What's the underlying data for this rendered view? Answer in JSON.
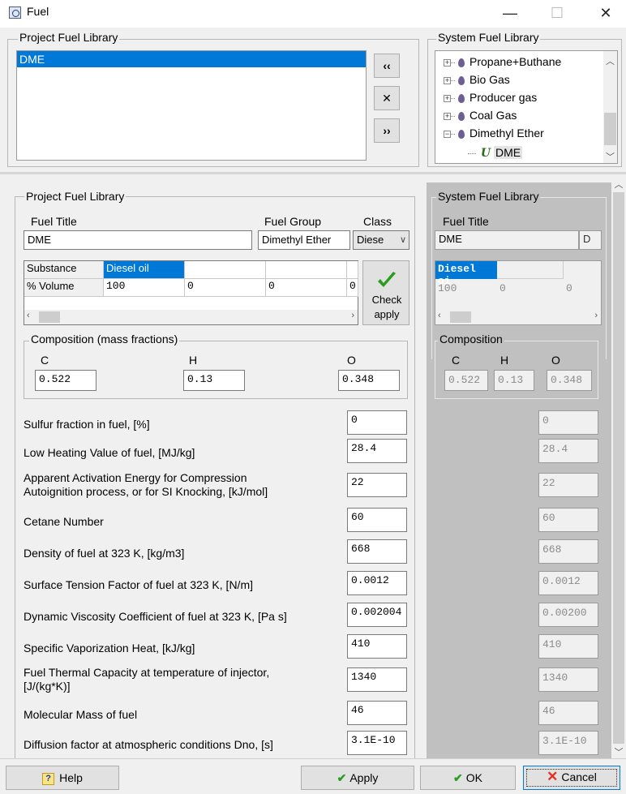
{
  "window": {
    "title": "Fuel",
    "min_label": "—",
    "max_label": "☐",
    "close_label": "✕"
  },
  "top": {
    "project_group_label": "Project Fuel Library",
    "project_list": [
      "DME"
    ],
    "transfer_left_label": "‹‹",
    "remove_label": "✕",
    "transfer_right_label": "››",
    "system_group_label": "System Fuel Library",
    "system_tree": [
      {
        "label": "Propane+Buthane",
        "expander": "+"
      },
      {
        "label": "Bio Gas",
        "expander": "+"
      },
      {
        "label": "Producer gas",
        "expander": "+"
      },
      {
        "label": "Coal Gas",
        "expander": "+"
      },
      {
        "label": "Dimethyl Ether",
        "expander": "−"
      }
    ],
    "system_tree_child": {
      "icon_glyph": "U",
      "label": "DME"
    }
  },
  "left": {
    "group_label": "Project Fuel Library",
    "fuel_title_label": "Fuel Title",
    "fuel_title_value": "DME",
    "fuel_group_label": "Fuel Group",
    "fuel_group_value": "Dimethyl Ether",
    "class_label": "Class",
    "class_value": "Diese",
    "grid": {
      "row_headers": [
        "Substance",
        "% Volume"
      ],
      "substances": [
        "Diesel oil",
        "",
        "",
        ""
      ],
      "volumes": [
        "100",
        "0",
        "0",
        "0"
      ]
    },
    "check_apply_label_1": "Check",
    "check_apply_label_2": "apply",
    "composition_label": "Composition (mass fractions)",
    "comp": [
      {
        "label": "C",
        "value": "0.522"
      },
      {
        "label": "H",
        "value": "0.13"
      },
      {
        "label": "O",
        "value": "0.348"
      }
    ],
    "props": [
      {
        "label": "Sulfur fraction in fuel, [%]",
        "value": "0"
      },
      {
        "label": "Low Heating Value of fuel, [MJ/kg]",
        "value": "28.4"
      },
      {
        "label": "Apparent Activation Energy for Compression\nAutoignition process, or for SI Knocking, [kJ/mol]",
        "value": "22"
      },
      {
        "label": "Cetane Number",
        "value": "60"
      },
      {
        "label": "Density of fuel at 323 K, [kg/m3]",
        "value": "668"
      },
      {
        "label": "Surface Tension Factor of fuel at 323 K, [N/m]",
        "value": "0.0012"
      },
      {
        "label": "Dynamic Viscosity Coefficient of fuel at 323 K, [Pa s]",
        "value": "0.002004"
      },
      {
        "label": "Specific Vaporization Heat, [kJ/kg]",
        "value": "410"
      },
      {
        "label": "Fuel Thermal Capacity at temperature of injector,\n[J/(kg*K)]",
        "value": "1340"
      },
      {
        "label": "Molecular Mass of fuel",
        "value": "46"
      },
      {
        "label": "Diffusion factor at atmospheric conditions Dno, [s]",
        "value": "3.1E-10"
      }
    ]
  },
  "right": {
    "group_label": "System Fuel Library",
    "fuel_title_label": "Fuel Title",
    "fuel_title_value": "DME",
    "fuel_title_extra": "D",
    "grid_substance": "Diesel oi",
    "grid_volumes": [
      "100",
      "0",
      "0"
    ],
    "composition_label": "Composition",
    "comp": [
      {
        "label": "C",
        "value": "0.522"
      },
      {
        "label": "H",
        "value": "0.13"
      },
      {
        "label": "O",
        "value": "0.348"
      }
    ],
    "props": [
      "0",
      "28.4",
      "22",
      "60",
      "668",
      "0.0012",
      "0.00200",
      "410",
      "1340",
      "46",
      "3.1E-10"
    ]
  },
  "bottom": {
    "help_label": "Help",
    "help_icon": "?",
    "apply_label": "Apply",
    "ok_label": "OK",
    "cancel_label": "Cancel"
  },
  "colors": {
    "selection": "#0078d7",
    "panel_bg": "#f0f0f0",
    "right_panel_bg": "#c0c0c0",
    "check": "#2a9d1f",
    "cancel_x": "#e0321e"
  }
}
